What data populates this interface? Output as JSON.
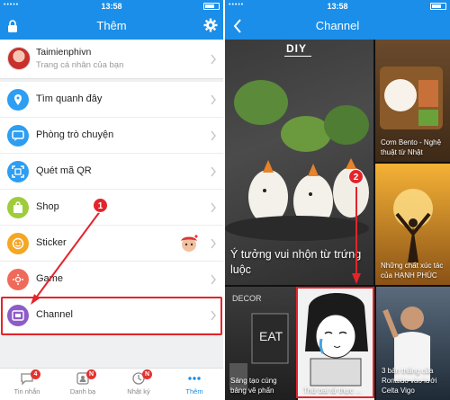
{
  "left": {
    "status": {
      "signal": "•••••",
      "time": "13:58"
    },
    "title": "Thêm",
    "profile": {
      "name": "Taimienphivn",
      "subtitle": "Trang cá nhân của bạn"
    },
    "menu": [
      {
        "label": "Tìm quanh đây",
        "icon": "location-pin-icon",
        "color": "#2d9ef2"
      },
      {
        "label": "Phòng trò chuyện",
        "icon": "chat-room-icon",
        "color": "#2d9ef2"
      },
      {
        "label": "Quét mã QR",
        "icon": "qr-scan-icon",
        "color": "#2d9ef2"
      },
      {
        "label": "Shop",
        "icon": "shop-bag-icon",
        "color": "#9fcc3b"
      },
      {
        "label": "Sticker",
        "icon": "sticker-smile-icon",
        "color": "#f5a623"
      },
      {
        "label": "Game",
        "icon": "gamepad-icon",
        "color": "#f06a5b"
      },
      {
        "label": "Channel",
        "icon": "channel-icon",
        "color": "#8e5cc9"
      }
    ],
    "tabs": [
      {
        "label": "Tin nhắn",
        "badge": "4",
        "icon": "message-icon"
      },
      {
        "label": "Danh bạ",
        "badge": "N",
        "icon": "contacts-icon"
      },
      {
        "label": "Nhật ký",
        "badge": "N",
        "icon": "clock-icon"
      },
      {
        "label": "Thêm",
        "badge": "",
        "icon": "more-icon"
      }
    ],
    "step": "1"
  },
  "right": {
    "status": {
      "signal": "•••••",
      "time": "13:58"
    },
    "title": "Channel",
    "diy": "DIY",
    "tiles": {
      "big": "Ý tưởng vui nhộn từ trứng luộc",
      "bento": "Cơm Bento - Nghệ thuật từ Nhật",
      "happy": "Những chất xúc tác của HẠNH PHÚC",
      "decor": "Sáng tạo cùng bảng vẽ phấn",
      "comic": "Thử bài tử thực ...",
      "ronaldo": "3 bản thắng của Ronaldo vào lưới Celta Vigo"
    },
    "step": "2"
  },
  "colors": {
    "brand": "#1a8ee8",
    "highlight": "#e3242b"
  }
}
